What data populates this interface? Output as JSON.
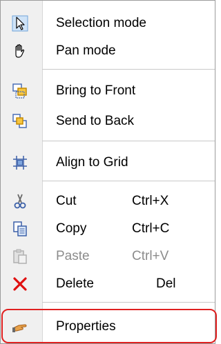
{
  "menu": {
    "items": [
      {
        "label": "Selection mode",
        "shortcut": "",
        "icon": "pointer-arrow-icon"
      },
      {
        "label": "Pan mode",
        "shortcut": "",
        "icon": "hand-icon"
      },
      {
        "label": "Bring to Front",
        "shortcut": "",
        "icon": "bring-to-front-icon"
      },
      {
        "label": "Send to Back",
        "shortcut": "",
        "icon": "send-to-back-icon"
      },
      {
        "label": "Align to Grid",
        "shortcut": "",
        "icon": "align-grid-icon"
      },
      {
        "label": "Cut",
        "shortcut": "Ctrl+X",
        "icon": "scissors-icon"
      },
      {
        "label": "Copy",
        "shortcut": "Ctrl+C",
        "icon": "copy-icon"
      },
      {
        "label": "Paste",
        "shortcut": "Ctrl+V",
        "icon": "paste-icon",
        "disabled": true
      },
      {
        "label": "Delete",
        "shortcut": "Del",
        "icon": "delete-x-icon"
      },
      {
        "label": "Properties",
        "shortcut": "",
        "icon": "properties-hand-icon"
      }
    ]
  },
  "colors": {
    "highlight_outline": "#e02020",
    "delete_icon": "#e01010",
    "gutter_bg": "#f0f0f0",
    "disabled_text": "#8c8c8c"
  }
}
